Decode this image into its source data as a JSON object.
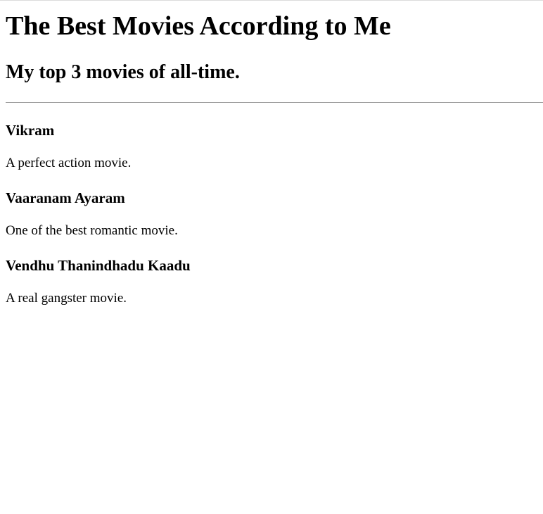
{
  "header": {
    "title": "The Best Movies According to Me",
    "subtitle": "My top 3 movies of all-time."
  },
  "movies": [
    {
      "title": "Vikram",
      "description": "A perfect action movie."
    },
    {
      "title": "Vaaranam Ayaram",
      "description": "One of the best romantic movie."
    },
    {
      "title": "Vendhu Thanindhadu Kaadu",
      "description": "A real gangster movie."
    }
  ]
}
